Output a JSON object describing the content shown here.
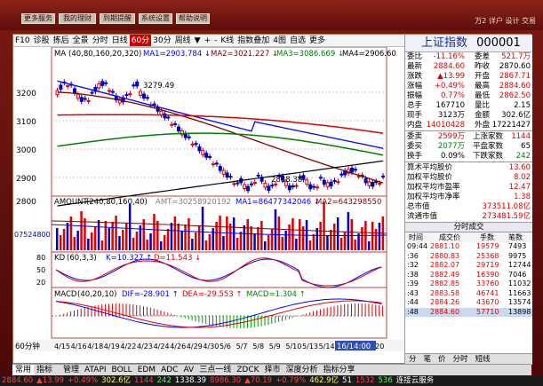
{
  "window": {
    "top_buttons": [
      "更多服务",
      "我的理财",
      "到期提醒",
      "系统设置",
      "帮助说明"
    ],
    "top_right": "万2 详户  设计  交易"
  },
  "toolbar": {
    "items": [
      "F10",
      "诊股",
      "拣后",
      "全景",
      "分时",
      "日线",
      "60分",
      "30分",
      "周线",
      "▼",
      "+",
      "-",
      "K线",
      "指数叠加",
      "4图",
      "自选",
      "更多"
    ],
    "selected": "60分"
  },
  "main_panel": {
    "ma_label": "MA",
    "ma_params": "(40,80,160,20,320)",
    "ma1": "MA1=2903.784 ↓",
    "ma2": "MA2=3021.227 ↓",
    "ma3": "MA3=3086.669 ↓",
    "ma4": "MA4=2906.60",
    "high_label": "3279.49",
    "low_label": "2838.38",
    "price_ticks": [
      "3200",
      "3100",
      "3000",
      "2900",
      "2800"
    ]
  },
  "amount_panel": {
    "label": "AMOUNT",
    "params": "(240,80,160,40)",
    "amt": "AMT=30258920192",
    "ma1": "MA1=86477342046 ↓",
    "ma2": "MA2=643298550",
    "axis_label": "07524800"
  },
  "kd_panel": {
    "label": "KD",
    "params": "(60,3,3)",
    "k": "K=10.327 ↑",
    "d": "D=11.543 ↓",
    "ticks": [
      "80",
      "50",
      "20"
    ]
  },
  "macd_panel": {
    "label": "MACD",
    "params": "(40,20,10)",
    "dif": "DIF=-28.901 ↑",
    "dea": "DEA=-29.553 ↑",
    "macd": "MACD=1.304 ↑"
  },
  "xaxis": {
    "period": "60分钟",
    "dates": [
      "4/15",
      "4/16",
      "4/18",
      "4/19",
      "4/22",
      "4/23",
      "4/24",
      "4/26",
      "4/29",
      "4/30",
      "5/6",
      "5/7",
      "5/8",
      "5/9",
      "5/10",
      "5/13",
      "5/14",
      "5/16",
      "5/17",
      "5/20"
    ],
    "cursor": "16/14:00"
  },
  "quote": {
    "title": "上证指数",
    "code": "000001",
    "rows": [
      {
        "l1": "委比",
        "v1": "-11.16%",
        "l2": "委差",
        "v2": "521.7万"
      },
      {
        "l1": "最新",
        "v1": "2884.60",
        "l2": "昨收",
        "v2": "2870.60"
      },
      {
        "l1": "涨跌",
        "v1": "▲13.99",
        "l2": "开盘",
        "v2": "2867.71"
      },
      {
        "l1": "涨幅",
        "v1": "+0.49%",
        "l2": "最高",
        "v2": "2884.60"
      },
      {
        "l1": "振幅",
        "v1": "0.77%",
        "l2": "最低",
        "v2": "2862.50"
      },
      {
        "l1": "总手",
        "v1": "167710",
        "l2": "量比",
        "v2": "2.15"
      },
      {
        "l1": "现手",
        "v1": "3123万",
        "l2": "金额",
        "v2": "302.6亿"
      },
      {
        "l1": "内盘",
        "v1": "14010428",
        "l2": "外盘",
        "v2": "17221427"
      }
    ],
    "rows2": [
      {
        "l1": "委卖",
        "v1": "2599万",
        "l2": "上涨家数",
        "v2": "1144"
      },
      {
        "l1": "委买",
        "v1": "2077万",
        "l2": "平盘家数",
        "v2": "65"
      },
      {
        "l1": "换手",
        "v1": "0.09%",
        "l2": "下跌家数",
        "v2": "242"
      }
    ],
    "rows3": [
      {
        "l": "算术平均股价",
        "v": "13.60"
      },
      {
        "l": "加权平均股价",
        "v": "8.02"
      },
      {
        "l": "加权平均市盈率",
        "v": "12.47"
      },
      {
        "l": "加权平均市净率",
        "v": "1.38"
      },
      {
        "l": "总市值",
        "v": "373511.08亿"
      },
      {
        "l": "流通市值",
        "v": "273481.59亿"
      }
    ]
  },
  "deals": {
    "title": "分时成交",
    "cols": [
      "时间",
      "成交价",
      "手数",
      "笔数"
    ],
    "rows": [
      {
        "t": "09:44",
        "p": "2881.10",
        "s": "19579",
        "n": "7493"
      },
      {
        "t": ":36",
        "p": "2880.83",
        "s": "25368",
        "n": "9975"
      },
      {
        "t": ":32",
        "p": "2882.07",
        "s": "29719",
        "n": "12744"
      },
      {
        "t": ":38",
        "p": "2882.49",
        "s": "16390",
        "n": "7046"
      },
      {
        "t": ":39",
        "p": "2882.85",
        "s": "33760",
        "n": "11032"
      },
      {
        "t": ":43",
        "p": "2883.58",
        "s": "46741",
        "n": "11663"
      },
      {
        "t": ":44",
        "p": "2884.26",
        "s": "43670",
        "n": "13574"
      },
      {
        "t": ":48",
        "p": "2884.60",
        "s": "57710",
        "n": "13898"
      }
    ],
    "tabs": [
      "分",
      "笔",
      "价",
      "分时",
      "短线"
    ]
  },
  "bottom_tabs": [
    "常用",
    "指标",
    "",
    "管理",
    "ATAPI",
    "BOLL",
    "EDM",
    "ADC",
    "AV",
    "三点一线",
    "ZDCK",
    "择市",
    "深度分析",
    "指标分享"
  ],
  "status": [
    "2884.60",
    "▲13.99",
    "+0.49%",
    "302.6亿",
    "1144",
    "242",
    "1338.39",
    "8986.30",
    "▲70.19",
    "+0.79%",
    "462.9亿",
    "51",
    "1532",
    "536",
    "连接云服务"
  ],
  "colors": {
    "red": "#e00000",
    "green": "#00a000",
    "ma1": "#0000ff",
    "ma2": "#800000",
    "ma3": "#008000",
    "ma4": "#000000"
  }
}
